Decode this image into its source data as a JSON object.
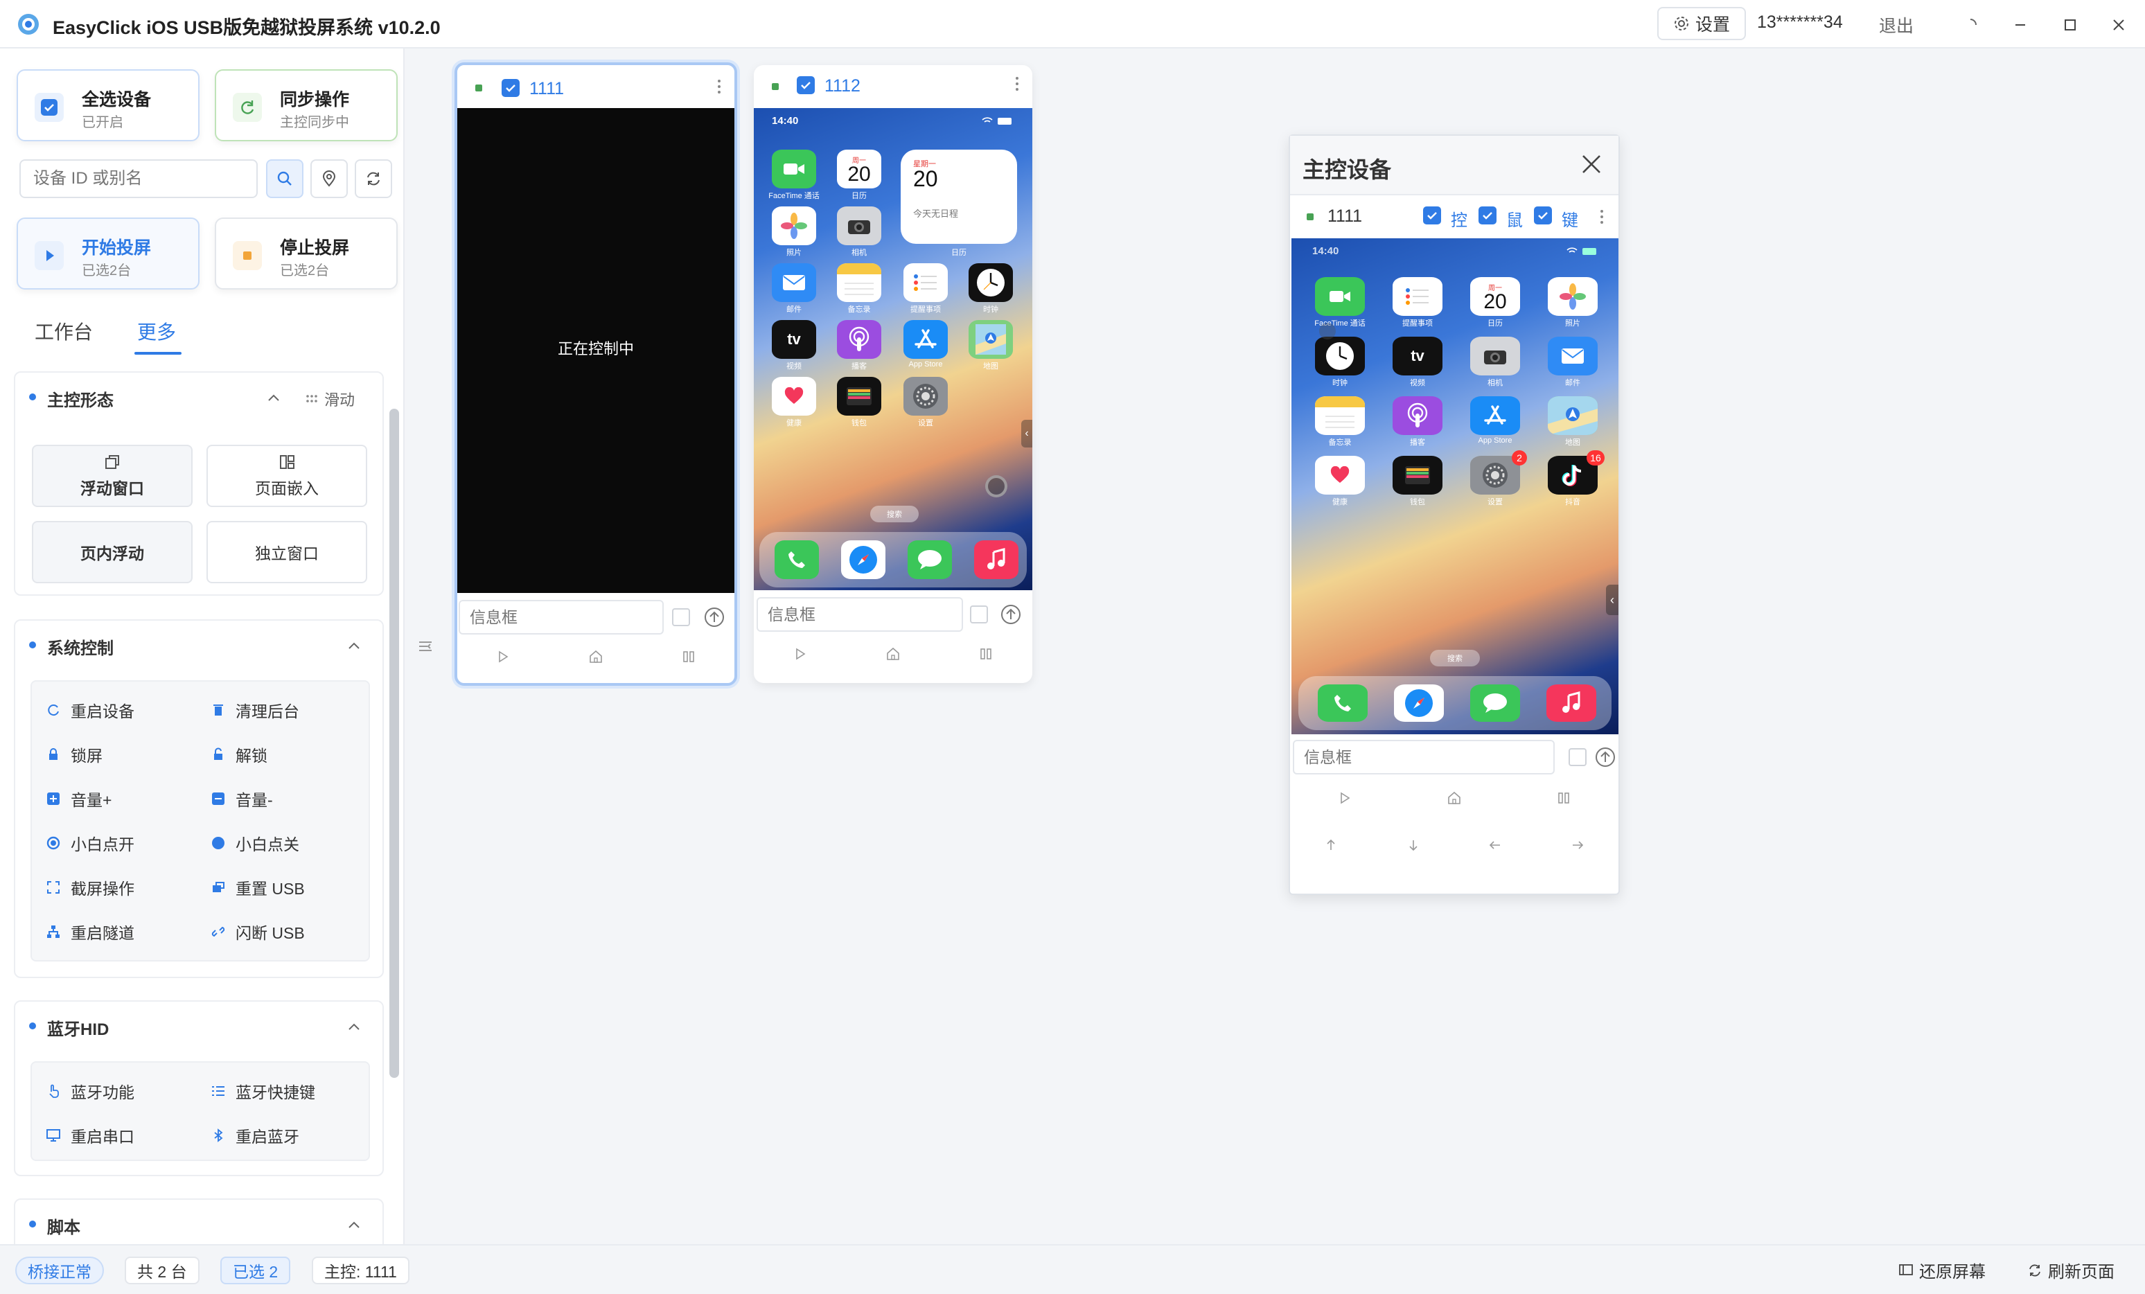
{
  "window": {
    "title": "EasyClick iOS USB版免越狱投屏系统 v10.2.0",
    "settings_label": "设置",
    "user_phone": "13*******34",
    "logout_label": "退出"
  },
  "sidebar": {
    "select_all": {
      "title": "全选设备",
      "sub": "已开启"
    },
    "sync": {
      "title": "同步操作",
      "sub": "主控同步中"
    },
    "search_placeholder": "设备 ID 或别名",
    "start_cast": {
      "title": "开始投屏",
      "sub": "已选2台"
    },
    "stop_cast": {
      "title": "停止投屏",
      "sub": "已选2台"
    },
    "tabs": [
      {
        "label": "工作台"
      },
      {
        "label": "更多"
      }
    ],
    "master_mode": {
      "title": "主控形态",
      "slide_label": "滑动",
      "modes": [
        "浮动窗口",
        "页面嵌入",
        "页内浮动",
        "独立窗口"
      ]
    },
    "system_control": {
      "title": "系统控制",
      "items": [
        "重启设备",
        "清理后台",
        "锁屏",
        "解锁",
        "音量+",
        "音量-",
        "小白点开",
        "小白点关",
        "截屏操作",
        "重置 USB",
        "重启隧道",
        "闪断 USB"
      ]
    },
    "bluetooth": {
      "title": "蓝牙HID",
      "items": [
        "蓝牙功能",
        "蓝牙快捷键",
        "重启串口",
        "重启蓝牙"
      ]
    },
    "script": {
      "title": "脚本"
    }
  },
  "devices": [
    {
      "name": "1111",
      "overlay": "正在控制中",
      "info_placeholder": "信息框"
    },
    {
      "name": "1112",
      "info_placeholder": "信息框"
    }
  ],
  "phone": {
    "time": "14:40",
    "weekday": "星期一",
    "day": "20",
    "no_events": "今天无日程",
    "calendar_label": "日历",
    "search_label": "搜索",
    "apps": [
      "FaceTime 通话",
      "日历",
      "照片",
      "相机",
      "邮件",
      "备忘录",
      "提醒事项",
      "时钟",
      "视频",
      "播客",
      "App Store",
      "地图",
      "健康",
      "钱包",
      "设置"
    ],
    "float_apps": [
      "FaceTime 通话",
      "提醒事项",
      "日历",
      "照片",
      "时钟",
      "视频",
      "相机",
      "邮件",
      "备忘录",
      "播客",
      "App Store",
      "地图",
      "健康",
      "钱包",
      "设置",
      "抖音"
    ],
    "badge_settings": "2",
    "badge_tiktok": "16"
  },
  "float_window": {
    "title": "主控设备",
    "device_name": "1111",
    "opt_control": "控",
    "opt_mouse": "鼠",
    "opt_keyboard": "键",
    "info_placeholder": "信息框"
  },
  "status": {
    "bridge": "桥接正常",
    "total": "共 2 台",
    "selected": "已选 2",
    "master": "主控: 1111",
    "restore": "还原屏幕",
    "refresh": "刷新页面"
  },
  "colors": {
    "accent": "#2f7be5",
    "green": "#48a254",
    "orange": "#f2a53a"
  }
}
